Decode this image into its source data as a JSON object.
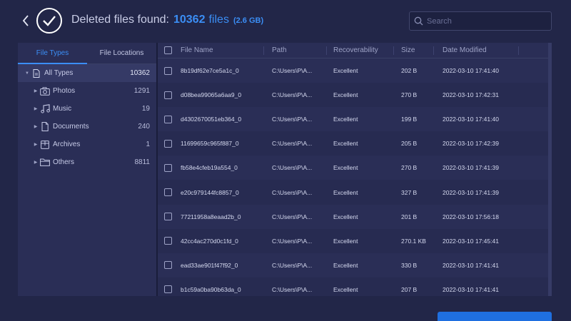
{
  "header": {
    "title_prefix": "Deleted files found:",
    "count": "10362",
    "unit": "files",
    "size": "(2.6 GB)"
  },
  "search": {
    "placeholder": "Search"
  },
  "tabs": [
    {
      "label": "File Types",
      "active": true
    },
    {
      "label": "File Locations",
      "active": false
    }
  ],
  "tree": [
    {
      "label": "All Types",
      "count": "10362",
      "icon": "document-icon"
    },
    {
      "label": "Photos",
      "count": "1291",
      "icon": "camera-icon"
    },
    {
      "label": "Music",
      "count": "19",
      "icon": "music-icon"
    },
    {
      "label": "Documents",
      "count": "240",
      "icon": "file-icon"
    },
    {
      "label": "Archives",
      "count": "1",
      "icon": "archive-icon"
    },
    {
      "label": "Others",
      "count": "8811",
      "icon": "folder-icon"
    }
  ],
  "table": {
    "columns": [
      "File Name",
      "Path",
      "Recoverability",
      "Size",
      "Date Modified"
    ],
    "rows": [
      {
        "name": "8b19df62e7ce5a1c_0",
        "path": "C:\\Users\\P\\A...",
        "recoverability": "Excellent",
        "size": "202 B",
        "date": "2022-03-10 17:41:40"
      },
      {
        "name": "d08bea99065a6aa9_0",
        "path": "C:\\Users\\P\\A...",
        "recoverability": "Excellent",
        "size": "270 B",
        "date": "2022-03-10 17:42:31"
      },
      {
        "name": "d4302670051eb364_0",
        "path": "C:\\Users\\P\\A...",
        "recoverability": "Excellent",
        "size": "199 B",
        "date": "2022-03-10 17:41:40"
      },
      {
        "name": "11699659c965f887_0",
        "path": "C:\\Users\\P\\A...",
        "recoverability": "Excellent",
        "size": "205 B",
        "date": "2022-03-10 17:42:39"
      },
      {
        "name": "fb58e4cfeb19a554_0",
        "path": "C:\\Users\\P\\A...",
        "recoverability": "Excellent",
        "size": "270 B",
        "date": "2022-03-10 17:41:39"
      },
      {
        "name": "e20c979144fc8857_0",
        "path": "C:\\Users\\P\\A...",
        "recoverability": "Excellent",
        "size": "327 B",
        "date": "2022-03-10 17:41:39"
      },
      {
        "name": "77211958a8eaad2b_0",
        "path": "C:\\Users\\P\\A...",
        "recoverability": "Excellent",
        "size": "201 B",
        "date": "2022-03-10 17:56:18"
      },
      {
        "name": "42cc4ac270d0c1fd_0",
        "path": "C:\\Users\\P\\A...",
        "recoverability": "Excellent",
        "size": "270.1 KB",
        "date": "2022-03-10 17:45:41"
      },
      {
        "name": "ead33ae901f47f92_0",
        "path": "C:\\Users\\P\\A...",
        "recoverability": "Excellent",
        "size": "330 B",
        "date": "2022-03-10 17:41:41"
      },
      {
        "name": "b1c59a0ba90b63da_0",
        "path": "C:\\Users\\P\\A...",
        "recoverability": "Excellent",
        "size": "207 B",
        "date": "2022-03-10 17:41:41"
      }
    ]
  },
  "colors": {
    "background": "#222648",
    "panel": "#2a2e56",
    "accent": "#3b8ef5",
    "button": "#1f6fe0"
  }
}
